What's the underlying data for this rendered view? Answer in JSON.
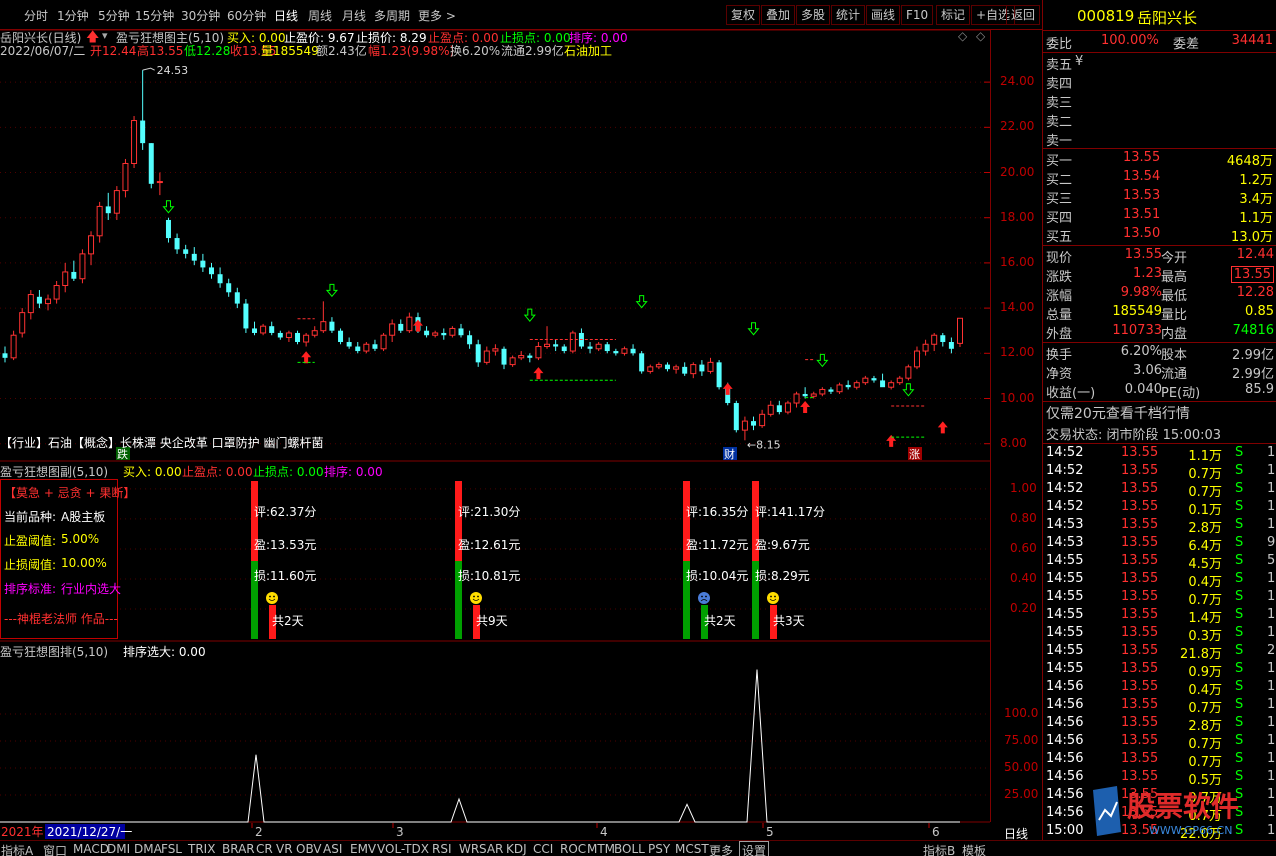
{
  "periods": [
    "分时",
    "1分钟",
    "5分钟",
    "15分钟",
    "30分钟",
    "60分钟",
    "日线",
    "周线",
    "月线",
    "多周期",
    "更多 >"
  ],
  "active_period": "日线",
  "toolbar": [
    "复权",
    "叠加",
    "多股",
    "统计",
    "画线",
    "F10",
    "标记",
    "+自选",
    "返回"
  ],
  "main_header": {
    "stock": "岳阳兴长(日线)",
    "indicator": "盈亏狂想图主(5,10)",
    "buy": "买入: 0.00",
    "profit_price": "止盈价: 9.67",
    "loss_price": "止损价: 8.29",
    "profit_point": "止盈点: 0.00",
    "loss_point": "止损点: 0.00",
    "sort": "排序: 0.00"
  },
  "quote_line": {
    "date": "2022/06/07/二",
    "open": "开12.44",
    "high": "高13.55",
    "low": "低12.28",
    "close": "收13.55",
    "vol": "量185549",
    "amt": "额2.43亿",
    "amp": "幅1.23(9.98%)",
    "turn": "换6.20%",
    "float": "流通2.99亿",
    "sector": "石油加工"
  },
  "annotations": {
    "high_label": "24.53",
    "low_label": "8.15",
    "industry_line": "【行业】石油【概念】长株潭 央企改革 口罩防护 幽门螺杆菌",
    "tag_die": "跌",
    "tag_cai": "财",
    "tag_zhang": "涨"
  },
  "main_axis": [
    "24.00",
    "22.00",
    "20.00",
    "18.00",
    "16.00",
    "14.00",
    "12.00",
    "10.00",
    "8.00"
  ],
  "sub1_header": {
    "name": "盈亏狂想图副(5,10)",
    "buy": "买入: 0.00",
    "profit": "止盈点: 0.00",
    "loss": "止损点: 0.00",
    "sort": "排序: 0.00"
  },
  "sub1_axis": [
    "1.00",
    "0.80",
    "0.60",
    "0.40",
    "0.20"
  ],
  "infobox": {
    "title": "【莫急 + 忌贪 + 果断】",
    "kind": "当前品种:",
    "kind_val": "A股主板",
    "tp": "止盈阈值:",
    "tp_val": "5.00%",
    "sl": "止损阈值:",
    "sl_val": "10.00%",
    "sort": "排序标准:",
    "sort_val": "行业内选大",
    "author": "---神棍老法师 作品---"
  },
  "trades": [
    {
      "score": "评:62.37分",
      "profit": "盈:13.53元",
      "loss": "损:11.60元",
      "days": "共2天",
      "face": "happy"
    },
    {
      "score": "评:21.30分",
      "profit": "盈:12.61元",
      "loss": "损:10.81元",
      "days": "共9天",
      "face": "happy"
    },
    {
      "score": "评:16.35分",
      "profit": "盈:11.72元",
      "loss": "损:10.04元",
      "days": "共2天",
      "face": "sad"
    },
    {
      "score": "评:141.17分",
      "profit": "盈:9.67元",
      "loss": "损:8.29元",
      "days": "共3天",
      "face": "happy"
    }
  ],
  "sub2_header": {
    "name": "盈亏狂想图排(5,10)",
    "sort": "排序选大: 0.00"
  },
  "sub2_axis": [
    "100.0",
    "75.00",
    "50.00",
    "25.00"
  ],
  "timeline": {
    "year": "2021年",
    "cursor": "2021/12/27/一",
    "months": [
      "2",
      "3",
      "4",
      "5",
      "6"
    ]
  },
  "bottom_tabs": [
    "指标A",
    "窗口",
    "MACD",
    "DMI",
    "DMA",
    "FSL",
    "TRIX",
    "BRAR",
    "CR",
    "VR",
    "OBV",
    "ASI",
    "EMV",
    "VOL-TDX",
    "RSI",
    "WR",
    "SAR",
    "KDJ",
    "CCI",
    "ROC",
    "MTM",
    "BOLL",
    "PSY",
    "MCST",
    "更多",
    "设置"
  ],
  "bottom_right": [
    "指标B",
    "模板"
  ],
  "right_bottom_label": "日线",
  "panel": {
    "code": "000819",
    "name": "岳阳兴长",
    "weibi_label": "委比",
    "weibi": "100.00%",
    "weicha_label": "委差",
    "weicha": "34441",
    "sell": [
      {
        "label": "卖五",
        "price": "",
        "vol": "",
        "mark": "¥"
      },
      {
        "label": "卖四",
        "price": "",
        "vol": ""
      },
      {
        "label": "卖三",
        "price": "",
        "vol": ""
      },
      {
        "label": "卖二",
        "price": "",
        "vol": ""
      },
      {
        "label": "卖一",
        "price": "",
        "vol": ""
      }
    ],
    "buy": [
      {
        "label": "买一",
        "price": "13.55",
        "vol": "4648万"
      },
      {
        "label": "买二",
        "price": "13.54",
        "vol": "1.2万"
      },
      {
        "label": "买三",
        "price": "13.53",
        "vol": "3.4万"
      },
      {
        "label": "买四",
        "price": "13.51",
        "vol": "1.1万"
      },
      {
        "label": "买五",
        "price": "13.50",
        "vol": "13.0万"
      }
    ],
    "stats": [
      {
        "l1": "现价",
        "v1": "13.55",
        "l2": "今开",
        "v2": "12.44",
        "c1": "#ff3030",
        "c2": "#ff3030"
      },
      {
        "l1": "涨跌",
        "v1": "1.23",
        "l2": "最高",
        "v2": "13.55",
        "c1": "#ff3030",
        "c2": "#ff3030"
      },
      {
        "l1": "涨幅",
        "v1": "9.98%",
        "l2": "最低",
        "v2": "12.28",
        "c1": "#ff3030",
        "c2": "#ff3030"
      },
      {
        "l1": "总量",
        "v1": "185549",
        "l2": "量比",
        "v2": "0.85",
        "c1": "#ffff00",
        "c2": "#ffff00"
      },
      {
        "l1": "外盘",
        "v1": "110733",
        "l2": "内盘",
        "v2": "74816",
        "c1": "#ff3030",
        "c2": "#00ff00"
      }
    ],
    "stats2": [
      {
        "l1": "换手",
        "v1": "6.20%",
        "l2": "股本",
        "v2": "2.99亿"
      },
      {
        "l1": "净资",
        "v1": "3.06",
        "l2": "流通",
        "v2": "2.99亿"
      },
      {
        "l1": "收益(一)",
        "v1": "0.040",
        "l2": "PE(动)",
        "v2": "85.9"
      }
    ],
    "promo": "仅需20元查看千档行情",
    "status": "交易状态: 闭市阶段 15:00:03",
    "ticks": [
      {
        "t": "14:52",
        "p": "13.55",
        "v": "1.1万",
        "s": "S",
        "n": "1"
      },
      {
        "t": "14:52",
        "p": "13.55",
        "v": "0.7万",
        "s": "S",
        "n": "1"
      },
      {
        "t": "14:52",
        "p": "13.55",
        "v": "0.7万",
        "s": "S",
        "n": "1"
      },
      {
        "t": "14:52",
        "p": "13.55",
        "v": "0.1万",
        "s": "S",
        "n": "1"
      },
      {
        "t": "14:53",
        "p": "13.55",
        "v": "2.8万",
        "s": "S",
        "n": "1"
      },
      {
        "t": "14:53",
        "p": "13.55",
        "v": "6.4万",
        "s": "S",
        "n": "9"
      },
      {
        "t": "14:55",
        "p": "13.55",
        "v": "4.5万",
        "s": "S",
        "n": "5"
      },
      {
        "t": "14:55",
        "p": "13.55",
        "v": "0.4万",
        "s": "S",
        "n": "1"
      },
      {
        "t": "14:55",
        "p": "13.55",
        "v": "0.7万",
        "s": "S",
        "n": "1"
      },
      {
        "t": "14:55",
        "p": "13.55",
        "v": "1.4万",
        "s": "S",
        "n": "1"
      },
      {
        "t": "14:55",
        "p": "13.55",
        "v": "0.3万",
        "s": "S",
        "n": "1"
      },
      {
        "t": "14:55",
        "p": "13.55",
        "v": "21.8万",
        "s": "S",
        "n": "2"
      },
      {
        "t": "14:55",
        "p": "13.55",
        "v": "0.9万",
        "s": "S",
        "n": "1"
      },
      {
        "t": "14:56",
        "p": "13.55",
        "v": "0.4万",
        "s": "S",
        "n": "1"
      },
      {
        "t": "14:56",
        "p": "13.55",
        "v": "0.7万",
        "s": "S",
        "n": "1"
      },
      {
        "t": "14:56",
        "p": "13.55",
        "v": "2.8万",
        "s": "S",
        "n": "1"
      },
      {
        "t": "14:56",
        "p": "13.55",
        "v": "0.7万",
        "s": "S",
        "n": "1"
      },
      {
        "t": "14:56",
        "p": "13.55",
        "v": "0.7万",
        "s": "S",
        "n": "1"
      },
      {
        "t": "14:56",
        "p": "13.55",
        "v": "0.5万",
        "s": "S",
        "n": "1"
      },
      {
        "t": "14:56",
        "p": "13.55",
        "v": "0.7万",
        "s": "S",
        "n": "1"
      },
      {
        "t": "14:56",
        "p": "13.55",
        "v": "0.7万",
        "s": "S",
        "n": "1"
      },
      {
        "t": "15:00",
        "p": "13.55",
        "v": "22.0万",
        "s": "S",
        "n": "1"
      }
    ]
  },
  "watermark": "股票软件",
  "watermark_url": "WWW.GP66.CN",
  "chart_data": {
    "type": "candlestick",
    "price_range": [
      7.5,
      25.2
    ],
    "candles": [
      [
        12.0,
        12.3,
        11.6,
        11.8
      ],
      [
        11.8,
        13.0,
        11.7,
        12.8
      ],
      [
        12.9,
        14.0,
        12.7,
        13.8
      ],
      [
        13.8,
        14.8,
        13.5,
        14.6
      ],
      [
        14.5,
        14.8,
        14.0,
        14.2
      ],
      [
        14.2,
        14.6,
        13.9,
        14.4
      ],
      [
        14.4,
        15.2,
        14.2,
        15.0
      ],
      [
        15.0,
        16.0,
        14.7,
        15.6
      ],
      [
        15.6,
        16.1,
        15.2,
        15.3
      ],
      [
        15.3,
        16.6,
        15.1,
        16.4
      ],
      [
        16.4,
        17.4,
        15.9,
        17.2
      ],
      [
        17.2,
        18.7,
        16.9,
        18.5
      ],
      [
        18.5,
        19.1,
        17.9,
        18.2
      ],
      [
        18.2,
        19.4,
        17.9,
        19.2
      ],
      [
        19.2,
        20.6,
        18.9,
        20.4
      ],
      [
        20.4,
        22.5,
        20.2,
        22.3
      ],
      [
        22.3,
        24.53,
        21.0,
        21.3
      ],
      [
        21.3,
        21.3,
        19.3,
        19.5
      ],
      [
        19.6,
        20.0,
        19.0,
        19.6
      ],
      [
        17.9,
        18.0,
        16.9,
        17.1
      ],
      [
        17.1,
        17.3,
        16.4,
        16.6
      ],
      [
        16.6,
        16.8,
        16.2,
        16.4
      ],
      [
        16.4,
        16.7,
        15.9,
        16.1
      ],
      [
        16.1,
        16.4,
        15.6,
        15.8
      ],
      [
        15.8,
        16.0,
        15.3,
        15.5
      ],
      [
        15.5,
        15.8,
        14.9,
        15.1
      ],
      [
        15.1,
        15.3,
        14.5,
        14.7
      ],
      [
        14.7,
        14.9,
        14.0,
        14.2
      ],
      [
        14.2,
        14.4,
        12.9,
        13.1
      ],
      [
        13.1,
        13.4,
        12.8,
        12.9
      ],
      [
        12.9,
        13.3,
        12.8,
        13.2
      ],
      [
        13.2,
        13.4,
        12.8,
        12.9
      ],
      [
        12.9,
        13.0,
        12.6,
        12.7
      ],
      [
        12.7,
        13.0,
        12.5,
        12.9
      ],
      [
        12.9,
        13.0,
        12.4,
        12.5
      ],
      [
        12.5,
        12.9,
        12.3,
        12.8
      ],
      [
        12.8,
        13.2,
        12.7,
        13.0
      ],
      [
        13.0,
        14.3,
        12.9,
        13.4
      ],
      [
        13.4,
        13.6,
        12.9,
        13.0
      ],
      [
        13.0,
        13.1,
        12.4,
        12.5
      ],
      [
        12.5,
        12.7,
        12.2,
        12.3
      ],
      [
        12.3,
        12.5,
        12.0,
        12.1
      ],
      [
        12.1,
        12.5,
        12.0,
        12.4
      ],
      [
        12.4,
        12.6,
        12.1,
        12.2
      ],
      [
        12.2,
        12.9,
        12.1,
        12.8
      ],
      [
        12.8,
        13.5,
        12.5,
        13.3
      ],
      [
        13.3,
        13.5,
        12.9,
        13.0
      ],
      [
        13.0,
        13.8,
        12.9,
        13.6
      ],
      [
        13.6,
        13.8,
        12.9,
        13.0
      ],
      [
        13.0,
        13.2,
        12.7,
        12.8
      ],
      [
        12.8,
        13.0,
        12.7,
        12.9
      ],
      [
        12.9,
        13.1,
        12.6,
        12.8
      ],
      [
        12.8,
        13.2,
        12.7,
        13.1
      ],
      [
        13.1,
        13.3,
        12.7,
        12.8
      ],
      [
        12.8,
        13.0,
        12.2,
        12.4
      ],
      [
        12.4,
        12.6,
        11.4,
        11.6
      ],
      [
        11.6,
        12.3,
        11.5,
        12.1
      ],
      [
        12.1,
        12.4,
        11.9,
        12.2
      ],
      [
        12.2,
        12.3,
        11.3,
        11.5
      ],
      [
        11.5,
        11.9,
        11.4,
        11.8
      ],
      [
        11.8,
        12.1,
        11.7,
        11.9
      ],
      [
        11.9,
        12.0,
        11.6,
        11.8
      ],
      [
        11.8,
        12.5,
        11.7,
        12.3
      ],
      [
        12.3,
        13.2,
        12.2,
        12.4
      ],
      [
        12.4,
        12.6,
        12.1,
        12.3
      ],
      [
        12.3,
        12.4,
        12.0,
        12.1
      ],
      [
        12.1,
        13.0,
        12.0,
        12.9
      ],
      [
        12.9,
        13.1,
        12.2,
        12.3
      ],
      [
        12.3,
        12.5,
        12.0,
        12.2
      ],
      [
        12.2,
        12.5,
        12.1,
        12.4
      ],
      [
        12.4,
        12.5,
        12.0,
        12.1
      ],
      [
        12.1,
        12.2,
        11.9,
        12.0
      ],
      [
        12.0,
        12.3,
        11.9,
        12.2
      ],
      [
        12.2,
        12.4,
        11.9,
        12.0
      ],
      [
        12.0,
        12.1,
        11.1,
        11.2
      ],
      [
        11.2,
        11.5,
        11.1,
        11.4
      ],
      [
        11.4,
        11.6,
        11.3,
        11.5
      ],
      [
        11.5,
        11.6,
        11.2,
        11.3
      ],
      [
        11.3,
        11.5,
        11.1,
        11.4
      ],
      [
        11.4,
        11.6,
        11.0,
        11.1
      ],
      [
        11.1,
        11.6,
        10.9,
        11.5
      ],
      [
        11.5,
        11.7,
        11.0,
        11.2
      ],
      [
        11.2,
        11.8,
        11.1,
        11.6
      ],
      [
        11.6,
        11.7,
        10.4,
        10.5
      ],
      [
        10.5,
        10.7,
        9.7,
        9.8
      ],
      [
        9.8,
        9.9,
        8.5,
        8.6
      ],
      [
        8.6,
        9.2,
        8.15,
        9.0
      ],
      [
        9.0,
        9.2,
        8.6,
        8.8
      ],
      [
        8.8,
        9.5,
        8.7,
        9.3
      ],
      [
        9.3,
        9.9,
        9.2,
        9.7
      ],
      [
        9.7,
        9.9,
        9.3,
        9.4
      ],
      [
        9.4,
        9.9,
        9.3,
        9.8
      ],
      [
        9.8,
        10.3,
        9.6,
        10.2
      ],
      [
        10.2,
        10.5,
        10.0,
        10.1
      ],
      [
        10.1,
        10.3,
        10.0,
        10.2
      ],
      [
        10.2,
        10.5,
        10.1,
        10.4
      ],
      [
        10.4,
        10.5,
        10.2,
        10.3
      ],
      [
        10.3,
        10.7,
        10.2,
        10.6
      ],
      [
        10.6,
        10.8,
        10.4,
        10.5
      ],
      [
        10.5,
        10.8,
        10.4,
        10.7
      ],
      [
        10.7,
        11.0,
        10.6,
        10.9
      ],
      [
        10.9,
        11.0,
        10.7,
        10.8
      ],
      [
        10.8,
        11.1,
        10.6,
        10.5
      ],
      [
        10.5,
        10.8,
        10.4,
        10.7
      ],
      [
        10.7,
        11.0,
        10.6,
        10.9
      ],
      [
        10.9,
        11.5,
        10.8,
        11.4
      ],
      [
        11.4,
        12.3,
        11.3,
        12.1
      ],
      [
        12.1,
        12.6,
        11.9,
        12.4
      ],
      [
        12.4,
        12.9,
        12.1,
        12.8
      ],
      [
        12.8,
        12.9,
        12.3,
        12.5
      ],
      [
        12.5,
        12.7,
        12.0,
        12.2
      ],
      [
        12.44,
        13.55,
        12.28,
        13.55
      ]
    ],
    "sort_series_peaks": [
      {
        "index": 22,
        "value": 62.37
      },
      {
        "index": 40,
        "value": 21.3
      },
      {
        "index": 59,
        "value": 16.35
      },
      {
        "index": 66,
        "value": 141.17
      }
    ],
    "sub2_range": [
      0,
      150
    ]
  }
}
